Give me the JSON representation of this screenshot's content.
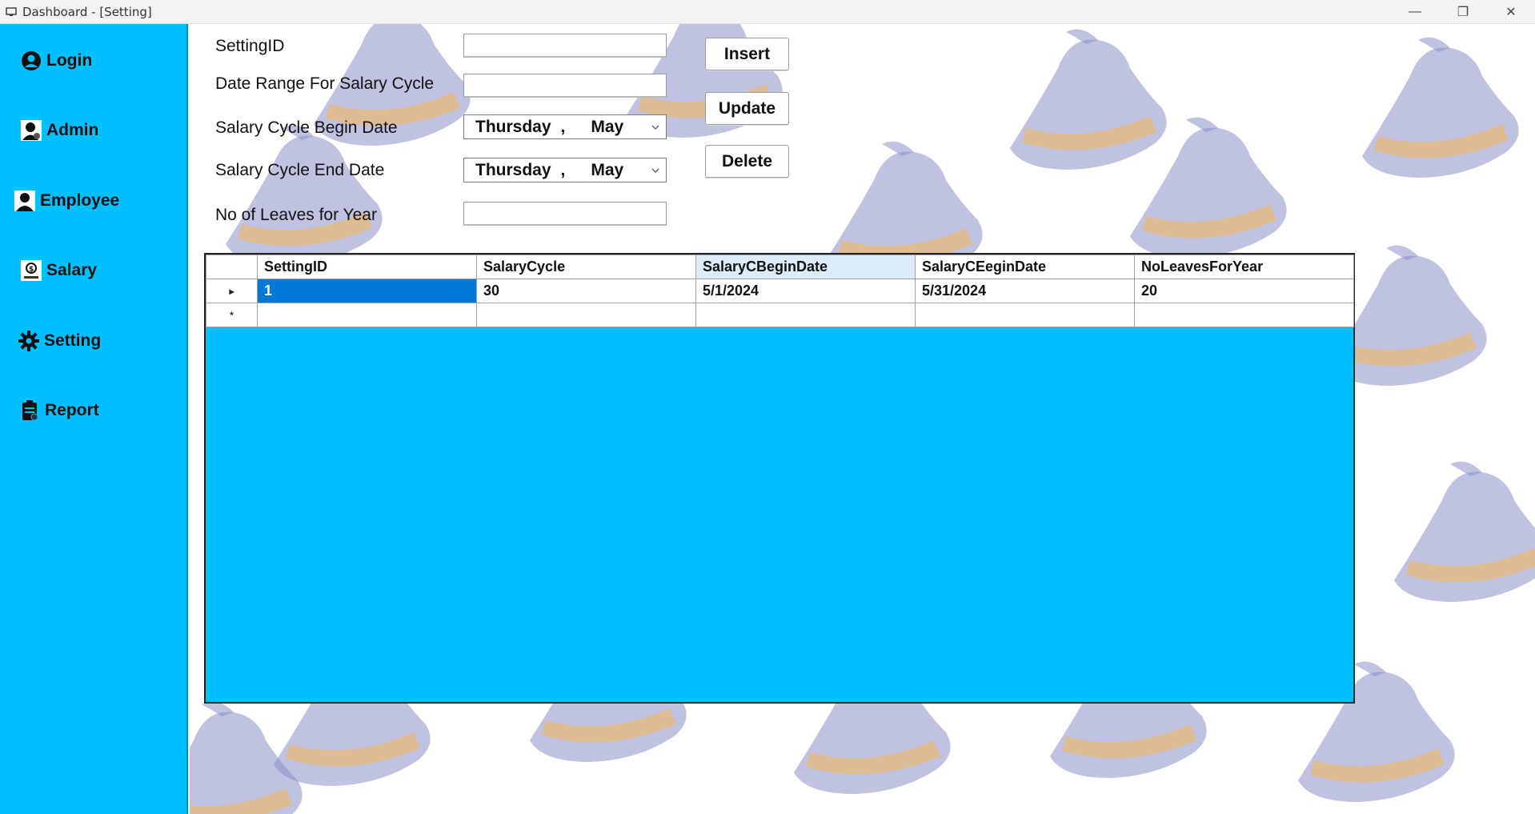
{
  "window": {
    "title": "Dashboard - [Setting]",
    "controls": {
      "minimize": "—",
      "restore": "❐",
      "close": "✕"
    }
  },
  "sidebar": {
    "items": [
      {
        "label": "Login",
        "icon": "user-circle-icon"
      },
      {
        "label": "Admin",
        "icon": "admin-user-icon"
      },
      {
        "label": "Employee",
        "icon": "employee-icon"
      },
      {
        "label": "Salary",
        "icon": "salary-icon"
      },
      {
        "label": "Setting",
        "icon": "gear-icon"
      },
      {
        "label": "Report",
        "icon": "clipboard-icon"
      }
    ]
  },
  "form": {
    "setting_id_label": "SettingID",
    "setting_id_value": "",
    "date_range_label": "Date Range For Salary Cycle",
    "date_range_value": "",
    "begin_date_label": "Salary Cycle Begin Date",
    "begin_date_day": "Thursday",
    "begin_date_sep": ",",
    "begin_date_month": "May",
    "end_date_label": "Salary Cycle End Date",
    "end_date_day": "Thursday",
    "end_date_sep": ",",
    "end_date_month": "May",
    "leaves_label": "No of Leaves for Year",
    "leaves_value": ""
  },
  "buttons": {
    "insert": "Insert",
    "update": "Update",
    "delete": "Delete"
  },
  "grid": {
    "columns": [
      "SettingID",
      "SalaryCycle",
      "SalaryCBeginDate",
      "SalaryCEeginDate",
      "NoLeavesForYear"
    ],
    "rows": [
      [
        "1",
        "30",
        "5/1/2024",
        "5/31/2024",
        "20"
      ]
    ],
    "current_row_marker": "▸",
    "new_row_marker": "*"
  },
  "colors": {
    "sidebar_bg": "#00bfff",
    "grid_bg": "#00bfff",
    "selected_cell": "#0078d7",
    "hat_body": "#8a90c8",
    "hat_band": "#e8b978"
  }
}
